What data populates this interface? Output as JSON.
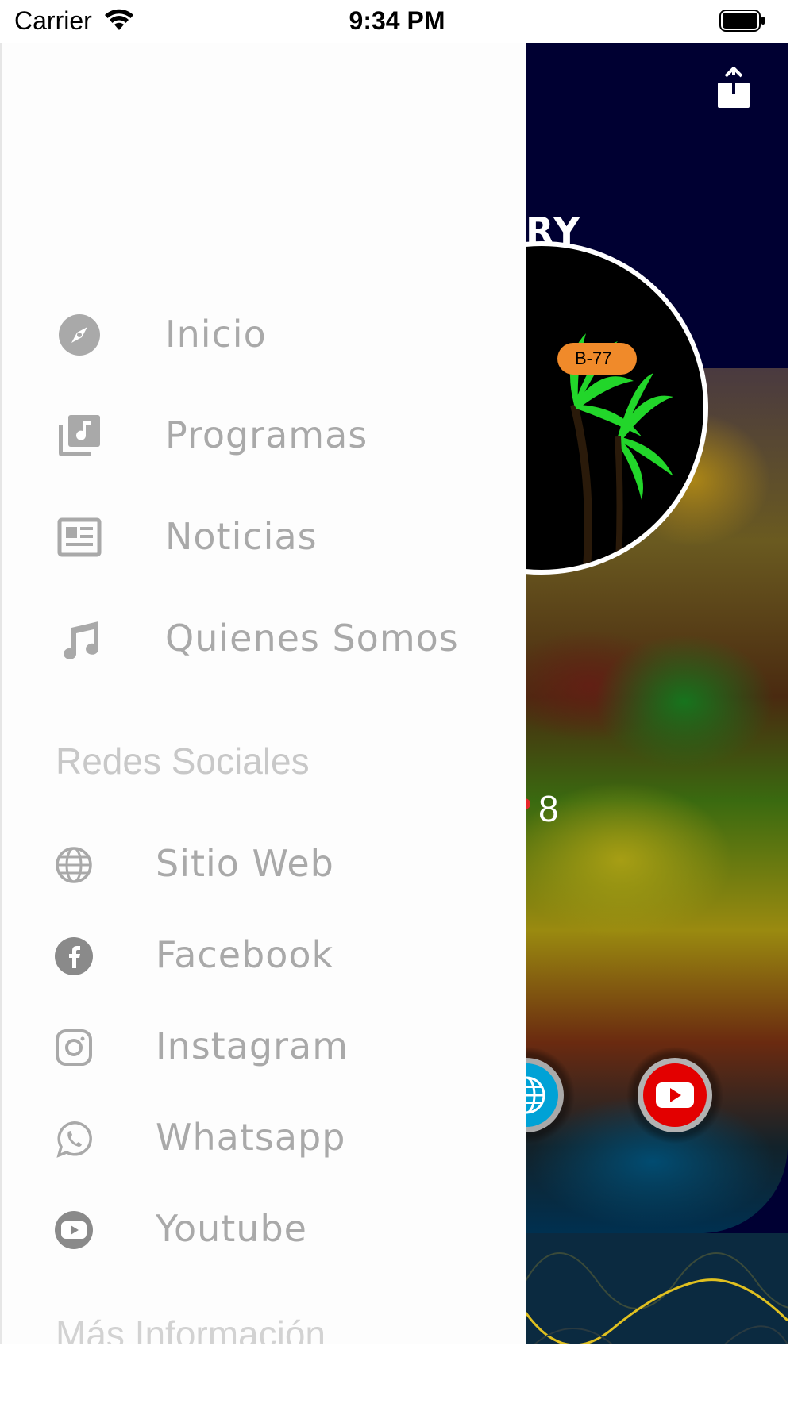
{
  "status_bar": {
    "carrier": "Carrier",
    "time": "9:34 PM"
  },
  "app": {
    "brand_fragment": "RY",
    "badge_text": "B-77",
    "number_fragment": "8"
  },
  "drawer": {
    "menu": [
      {
        "label": "Inicio",
        "icon": "compass-icon"
      },
      {
        "label": "Programas",
        "icon": "music-library-icon"
      },
      {
        "label": "Noticias",
        "icon": "newspaper-icon"
      },
      {
        "label": "Quienes  Somos",
        "icon": "music-note-icon"
      }
    ],
    "social_header": "Redes Sociales",
    "social": [
      {
        "label": "Sitio  Web",
        "icon": "globe-icon"
      },
      {
        "label": "Facebook",
        "icon": "facebook-icon"
      },
      {
        "label": "Instagram",
        "icon": "instagram-icon"
      },
      {
        "label": "Whatsapp",
        "icon": "whatsapp-icon"
      },
      {
        "label": "Youtube",
        "icon": "youtube-icon"
      }
    ],
    "more_header": "Más Información"
  },
  "colors": {
    "drawer_text": "#a9a9a9",
    "section_header": "#c8c8c8",
    "app_header_bg": "#000032",
    "badge": "#f08a2a"
  }
}
